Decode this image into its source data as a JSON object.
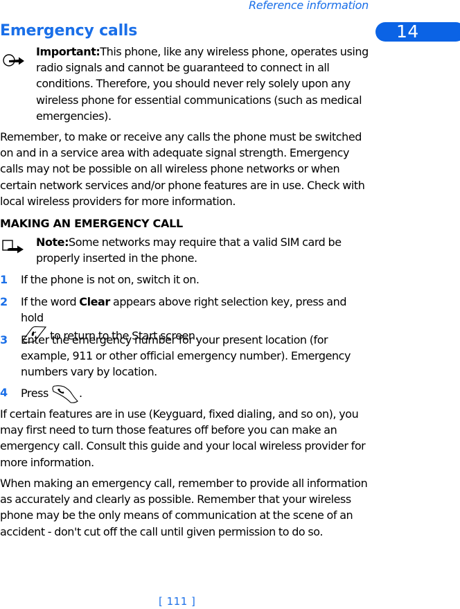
{
  "header": {
    "running_title": "Reference information",
    "chapter_number": "14"
  },
  "title": "Emergency calls",
  "important_callout": {
    "icon": "important-arrow-circle-icon",
    "label": "Important:",
    "text": "This phone, like any wireless phone, operates using radio signals and cannot be guaranteed to connect in all conditions. Therefore, you should never rely solely upon any wireless phone for essential communications (such as medical emergencies)."
  },
  "paragraphs": {
    "intro": "Remember, to make or receive any calls the phone must be switched on and in a service area with adequate signal strength. Emergency calls may not be possible on all wireless phone networks or when certain network services and/or phone features are in use. Check with local wireless providers for more information.",
    "features": "If certain features are in use (Keyguard, fixed dialing, and so on), you may first need to turn those features off before you can make an emergency call. Consult this guide and your local wireless provider for more information.",
    "closing": "When making an emergency call, remember to provide all information as accurately and clearly as possible. Remember that your wireless phone may be the only means of communication at the scene of an accident - don't cut off the call until given permission to do so."
  },
  "section": {
    "heading": "MAKING AN EMERGENCY CALL",
    "note_callout": {
      "icon": "note-arrow-square-icon",
      "label": "Note:",
      "text": "Some networks may require that a valid SIM card be properly inserted in the phone."
    },
    "steps": [
      {
        "number": "1",
        "text": "If the phone is not on, switch it on."
      },
      {
        "number": "2",
        "text_before": "If the word ",
        "bold_word": "Clear",
        "text_after": " appears above right selection key, press and hold",
        "key_icon": "end-key-icon",
        "text_end": " to return to the Start screen."
      },
      {
        "number": "3",
        "text": "Enter the emergency number for your present location (for example, 911 or other official emergency number). Emergency numbers vary by location."
      },
      {
        "number": "4",
        "text_before": "Press ",
        "key_icon": "talk-key-icon",
        "text_after": "."
      }
    ]
  },
  "footer": {
    "page_number": "[ 111 ]"
  },
  "colors": {
    "accent": "#1a6fe8",
    "badge": "#0b63e5",
    "text": "#000000"
  }
}
